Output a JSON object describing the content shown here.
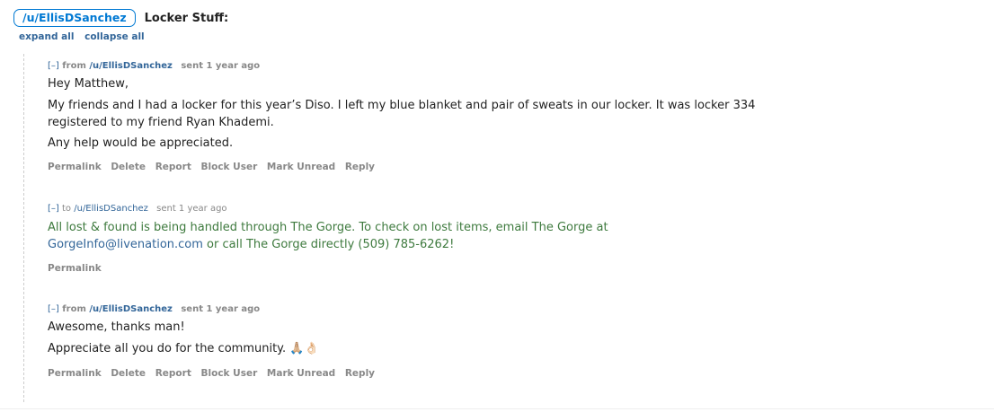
{
  "header": {
    "user": "/u/EllisDSanchez",
    "subject": "Locker Stuff:"
  },
  "toggles": {
    "expand": "expand all",
    "collapse": "collapse all"
  },
  "messages": [
    {
      "toggle": "[–]",
      "direction": "from",
      "user": "/u/EllisDSanchez",
      "time": "sent 1 year ago",
      "paragraphs": [
        "Hey Matthew,",
        "My friends and I had a locker for this year’s Diso. I left my blue blanket and pair of sweats in our locker. It was locker 334 registered to my friend Ryan Khademi.",
        "Any help would be appreciated."
      ],
      "actions": [
        "Permalink",
        "Delete",
        "Report",
        "Block User",
        "Mark Unread",
        "Reply"
      ]
    },
    {
      "toggle": "[–]",
      "direction": "to",
      "user": "/u/EllisDSanchez",
      "time": "sent 1 year ago",
      "text_before": "All lost & found is being handled through The Gorge. To check on lost items, email The Gorge at ",
      "email": "GorgeInfo@livenation.com",
      "text_after": " or call The Gorge directly (509) 785-6262!",
      "actions": [
        "Permalink"
      ]
    },
    {
      "toggle": "[–]",
      "direction": "from",
      "user": "/u/EllisDSanchez",
      "time": "sent 1 year ago",
      "paragraphs": [
        "Awesome, thanks man!",
        "Appreciate all you do for the community. 🙏🏼👌🏻"
      ],
      "actions": [
        "Permalink",
        "Delete",
        "Report",
        "Block User",
        "Mark Unread",
        "Reply"
      ]
    }
  ]
}
